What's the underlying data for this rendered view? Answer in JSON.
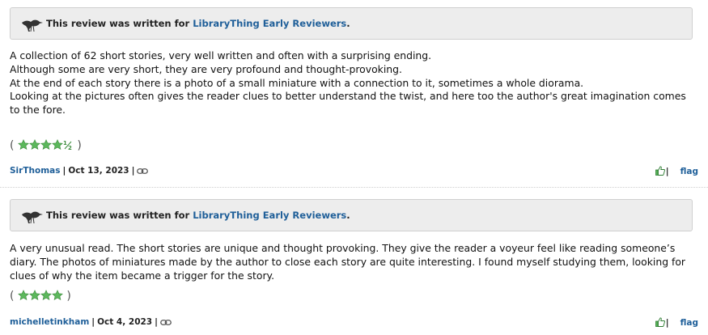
{
  "reviews": [
    {
      "banner": {
        "prefix": "This review was written for ",
        "link": "LibraryThing Early Reviewers",
        "suffix": "."
      },
      "paragraphs": [
        "A collection of 62 short stories, very well written and often with a surprising ending.",
        "Although some are very short, they are very profound and thought-provoking.",
        "At the end of each story there is a photo of a small miniature with a connection to it, sometimes a whole diorama.",
        "Looking at the pictures often gives the reader clues to better understand the twist, and here too the author's great imagination comes to the fore."
      ],
      "rating": {
        "value": 4.5,
        "max": 5,
        "open": "(",
        "close": ")"
      },
      "author": "SirThomas",
      "date": "Oct 13, 2023",
      "flag_label": "flag"
    },
    {
      "banner": {
        "prefix": "This review was written for ",
        "link": "LibraryThing Early Reviewers",
        "suffix": "."
      },
      "paragraphs": [
        "A very unusual read. The short stories are unique and thought provoking. They give the reader a voyeur feel like reading someone’s diary. The photos of miniatures made by the author to close each story are quite interesting. I found myself studying them, looking for clues of why the item became a trigger for the story."
      ],
      "rating": {
        "value": 4,
        "max": 5,
        "open": "(",
        "close": ")"
      },
      "author": "michelletinkham",
      "date": "Oct 4, 2023",
      "flag_label": "flag"
    }
  ],
  "colors": {
    "link": "#1f5f99",
    "star": "#5cb85c",
    "banner_bg": "#ededed"
  },
  "icons": {
    "banner": "bird-icon",
    "permalink": "link-icon",
    "helpful": "thumbs-up-icon"
  }
}
